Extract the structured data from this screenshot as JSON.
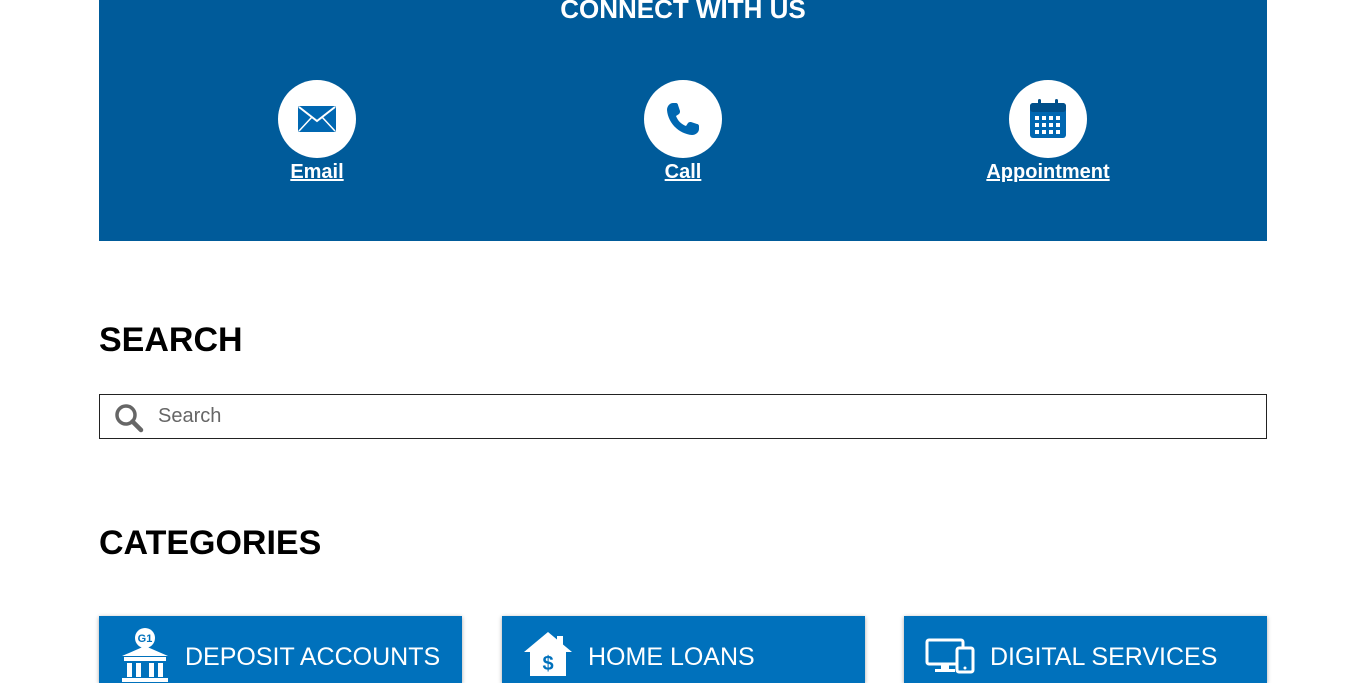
{
  "connect": {
    "title": "CONNECT WITH US",
    "items": [
      {
        "label": "Email",
        "icon": "envelope-icon"
      },
      {
        "label": "Call",
        "icon": "phone-icon"
      },
      {
        "label": "Appointment",
        "icon": "calendar-icon"
      }
    ]
  },
  "search": {
    "heading": "SEARCH",
    "placeholder": "Search",
    "value": ""
  },
  "categories": {
    "heading": "CATEGORIES",
    "items": [
      {
        "label": "DEPOSIT ACCOUNTS",
        "icon": "bank-icon",
        "icon_badge": "G1"
      },
      {
        "label": "HOME LOANS",
        "icon": "house-dollar-icon"
      },
      {
        "label": "DIGITAL SERVICES",
        "icon": "devices-icon"
      }
    ]
  },
  "colors": {
    "panel_blue": "#005b9a",
    "card_blue": "#0071bc",
    "icon_blue": "#0067b1"
  }
}
